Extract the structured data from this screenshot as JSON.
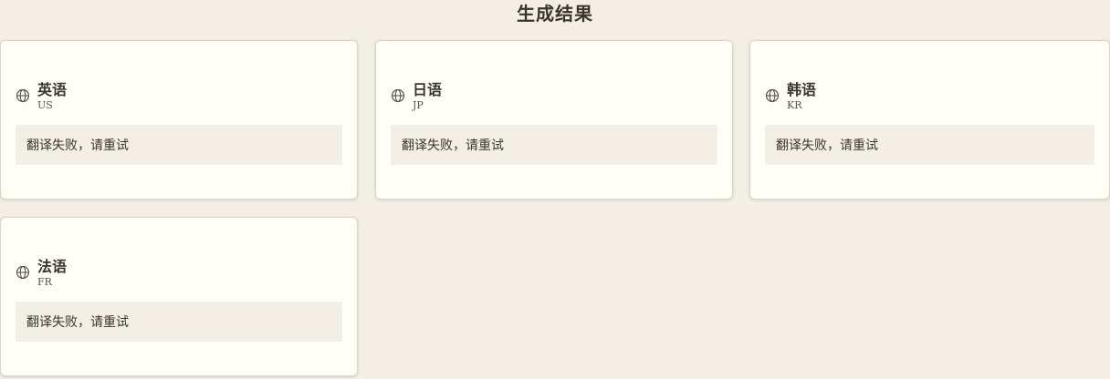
{
  "title": "生成结果",
  "cards": [
    {
      "name": "英语",
      "code": "US",
      "result": "翻译失败，请重试"
    },
    {
      "name": "日语",
      "code": "JP",
      "result": "翻译失败，请重试"
    },
    {
      "name": "韩语",
      "code": "KR",
      "result": "翻译失败，请重试"
    },
    {
      "name": "法语",
      "code": "FR",
      "result": "翻译失败，请重试"
    }
  ],
  "icon": "globe-icon",
  "colors": {
    "background": "#f3efe5",
    "card": "#fffdf6",
    "text": "#3b3530"
  }
}
